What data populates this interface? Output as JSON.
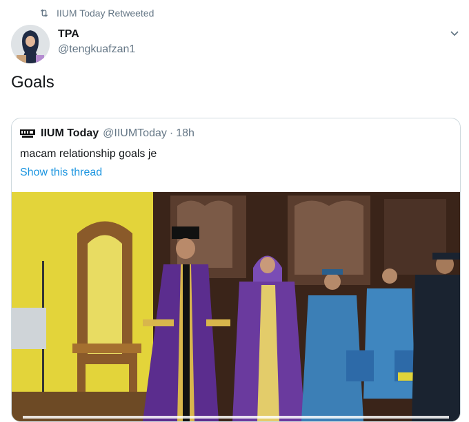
{
  "retweet": {
    "label": "IIUM Today Retweeted",
    "icon": "retweet-icon"
  },
  "author": {
    "name": "TPA",
    "handle": "@tengkuafzan1",
    "avatar_icon": "profile-avatar"
  },
  "menu": {
    "icon": "chevron-down-icon"
  },
  "tweet": {
    "text": "Goals"
  },
  "quote": {
    "logo_icon": "iium-today-logo",
    "name": "IIUM Today",
    "handle": "@IIUMToday",
    "separator": "·",
    "time": "18h",
    "text": "macam relationship goals je",
    "thread_link": "Show this thread"
  },
  "colors": {
    "link": "#1b95e0",
    "secondary": "#657786",
    "border": "#cfd9de",
    "robe_purple": "#5b2d8e",
    "stage_yellow": "#e3d43a"
  }
}
